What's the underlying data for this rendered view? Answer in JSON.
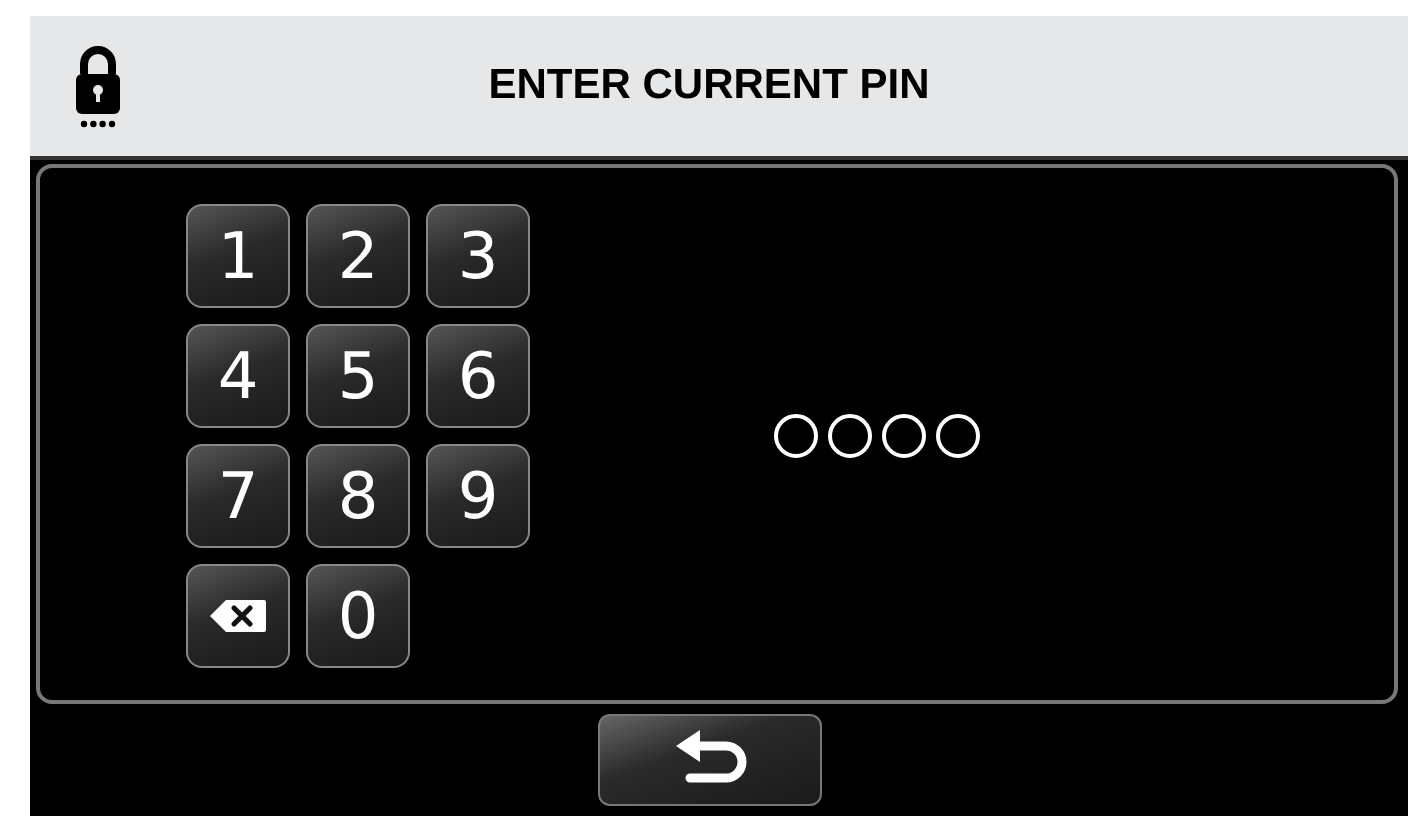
{
  "header": {
    "title": "ENTER CURRENT PIN"
  },
  "keypad": [
    {
      "kind": "digit",
      "label": "1"
    },
    {
      "kind": "digit",
      "label": "2"
    },
    {
      "kind": "digit",
      "label": "3"
    },
    {
      "kind": "digit",
      "label": "4"
    },
    {
      "kind": "digit",
      "label": "5"
    },
    {
      "kind": "digit",
      "label": "6"
    },
    {
      "kind": "digit",
      "label": "7"
    },
    {
      "kind": "digit",
      "label": "8"
    },
    {
      "kind": "digit",
      "label": "9"
    },
    {
      "kind": "backspace"
    },
    {
      "kind": "digit",
      "label": "0"
    }
  ],
  "pin_dots": [
    {
      "filled": false
    },
    {
      "filled": false
    },
    {
      "filled": false
    },
    {
      "filled": false
    }
  ]
}
